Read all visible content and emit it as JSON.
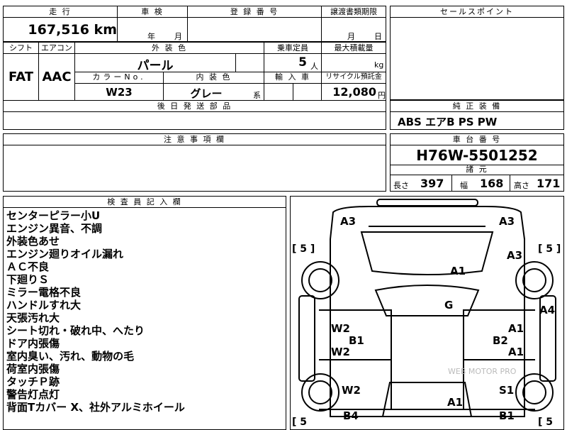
{
  "header": {
    "mileage_label": "走 行",
    "mileage_value": "167,516 km",
    "inspection_label": "車 検",
    "inspection_year": "年",
    "inspection_month": "月",
    "registration_label": "登 録 番 号",
    "transfer_label": "譲渡書類期限",
    "transfer_month": "月",
    "transfer_day": "日",
    "sales_point_label": "セールスポイント"
  },
  "specs": {
    "shift_label": "シフト",
    "shift_value": "FAT",
    "aircon_label": "エアコン",
    "aircon_value": "AAC",
    "exterior_label": "外 装 色",
    "exterior_value": "パール",
    "capacity_label": "乗車定員",
    "capacity_value": "5",
    "capacity_unit": "人",
    "load_label": "最大積載量",
    "load_unit": "kg",
    "color_no_label": "カラーNo.",
    "color_no_value": "W23",
    "interior_label": "内 装 色",
    "interior_value": "グレー",
    "interior_suffix": "系",
    "import_label": "輸 入 車",
    "recycle_label": "リサイクル預託金",
    "recycle_value": "12,080",
    "recycle_unit": "円",
    "parts_label": "後 日 発 送 部 品"
  },
  "equipment": {
    "label": "純 正 装 備",
    "value": "ABS エアB PS PW"
  },
  "notes": {
    "label": "注 意 事 項 欄"
  },
  "chassis": {
    "label": "車 台 番 号",
    "value": "H76W-5501252",
    "dims_label": "諸 元",
    "length_label": "長さ",
    "length_value": "397",
    "width_label": "幅",
    "width_value": "168",
    "height_label": "高さ",
    "height_value": "171"
  },
  "inspector": {
    "label": "検 査 員 記 入 欄",
    "lines": [
      "センターピラー小U",
      "エンジン異音、不調",
      "外装色あせ",
      "エンジン廻りオイル漏れ",
      "ＡＣ不良",
      "下廻りＳ",
      "ミラー電格不良",
      "ハンドルすれ大",
      "天張汚れ大",
      "シート切れ・破れ中、へたり",
      "ドア内張傷",
      "室内臭い、汚れ、動物の毛",
      "荷室内張傷",
      "タッチＰ跡",
      "警告灯点灯",
      "背面Tカバー X、社外アルミホイール"
    ]
  },
  "diagram": {
    "marks": {
      "a3_top_left": "A3",
      "a3_top_right": "A3",
      "a3_right": "A3",
      "a1_hood": "A1",
      "g_glass": "G",
      "a4_right": "A4",
      "w2_left_1": "W2",
      "b1_left": "B1",
      "w2_left_2": "W2",
      "a1_right_1": "A1",
      "b2_right": "B2",
      "a1_right_2": "A1",
      "w2_left_3": "W2",
      "s1_right": "S1",
      "a1_rear": "A1",
      "b4_left": "B4",
      "b1_right": "B1"
    },
    "tire_left_top": "[ 5 ]",
    "tire_right_top": "[ 5 ]",
    "tire_left_bottom": "[ 5",
    "tire_right_bottom": "[ 5",
    "watermark": "WEB MOTOR PRO"
  }
}
